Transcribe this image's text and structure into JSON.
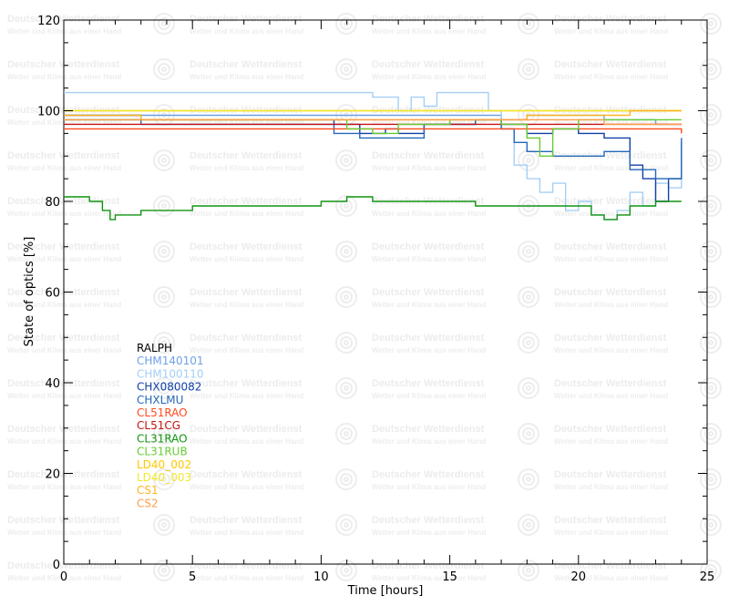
{
  "watermark": {
    "title": "Deutscher Wetterdienst",
    "subtitle": "Wetter und Klima aus einer Hand",
    "logo": "DWD"
  },
  "chart_data": {
    "type": "line",
    "title": "",
    "xlabel": "Time [hours]",
    "ylabel": "State of optics [%]",
    "xlim": [
      0,
      25
    ],
    "ylim": [
      0,
      120
    ],
    "xticks": [
      0,
      5,
      10,
      15,
      20,
      25
    ],
    "yticks": [
      0,
      20,
      40,
      60,
      80,
      100,
      120
    ],
    "grid": false,
    "legend_position": "left-middle",
    "series": [
      {
        "name": "RALPH",
        "color": "#000000",
        "x": [],
        "y": []
      },
      {
        "name": "CHM140101",
        "color": "#6fa0e6",
        "x": [
          0,
          3,
          6,
          9,
          12,
          15,
          17,
          18,
          19,
          20,
          21,
          22,
          23,
          24
        ],
        "y": [
          99,
          99,
          99,
          99,
          99,
          99,
          98,
          99,
          99,
          99,
          98,
          98,
          97,
          97
        ]
      },
      {
        "name": "CHM100110",
        "color": "#a5cff5",
        "x": [
          0,
          2,
          4,
          6,
          8,
          10,
          12,
          13,
          13.5,
          14,
          14.5,
          15,
          16,
          16.5,
          17,
          17.5,
          18,
          18.5,
          19,
          19.5,
          20,
          20.5,
          21,
          21.5,
          22,
          22.5,
          23,
          23.5,
          24
        ],
        "y": [
          104,
          104,
          104,
          104,
          104,
          104,
          103,
          100,
          103,
          101,
          104,
          104,
          104,
          100,
          96,
          88,
          85,
          82,
          84,
          78,
          80,
          77,
          76,
          78,
          82,
          79,
          84,
          83,
          88
        ]
      },
      {
        "name": "CHX080082",
        "color": "#1040a8",
        "x": [
          0,
          3,
          6,
          9,
          10.5,
          11.5,
          12.5,
          13,
          14,
          15,
          16,
          17,
          18,
          19,
          20,
          21,
          22,
          22.5,
          23,
          23.5,
          24
        ],
        "y": [
          99,
          98,
          98,
          98,
          97,
          95,
          96,
          95,
          97,
          97,
          98,
          97,
          95,
          96,
          95,
          94,
          88,
          85,
          80,
          85,
          93
        ]
      },
      {
        "name": "CHXLMU",
        "color": "#2468b8",
        "x": [
          0,
          3,
          6,
          9,
          10.5,
          11.5,
          12.5,
          14,
          15,
          16,
          17,
          17.5,
          18,
          19,
          20,
          21,
          22,
          23,
          24
        ],
        "y": [
          98,
          97,
          97,
          97,
          95,
          94,
          94,
          97,
          97,
          98,
          96,
          93,
          91,
          90,
          90,
          91,
          87,
          85,
          94
        ]
      },
      {
        "name": "CL51RAO",
        "color": "#ff4a1c",
        "x": [
          0,
          3,
          6,
          9,
          12,
          15,
          18,
          21,
          24
        ],
        "y": [
          96,
          96,
          96,
          96,
          96,
          96,
          96,
          96,
          95
        ]
      },
      {
        "name": "CL51CG",
        "color": "#c41414",
        "x": [
          0,
          3,
          6,
          9,
          12,
          15,
          18,
          21,
          24
        ],
        "y": [
          97,
          97,
          97,
          97,
          97,
          97,
          97,
          97,
          97
        ]
      },
      {
        "name": "CL31RAO",
        "color": "#119411",
        "x": [
          0,
          1,
          1.5,
          1.8,
          2,
          3,
          5,
          8,
          10,
          11,
          12,
          14,
          16,
          17,
          18,
          19,
          20,
          20.5,
          21,
          21.5,
          22,
          23,
          24
        ],
        "y": [
          81,
          80,
          78,
          76,
          77,
          78,
          79,
          79,
          80,
          81,
          80,
          80,
          79,
          79,
          79,
          79,
          79,
          77,
          76,
          77,
          79,
          80,
          80
        ]
      },
      {
        "name": "CL31RUB",
        "color": "#66cc33",
        "x": [
          0,
          4,
          8,
          10,
          11,
          12,
          13,
          15,
          17,
          18,
          18.5,
          19,
          20,
          24
        ],
        "y": [
          98,
          98,
          98,
          98,
          96,
          95,
          97,
          98,
          97,
          94,
          90,
          96,
          98,
          98
        ]
      },
      {
        "name": "LD40_002",
        "color": "#ffc800",
        "x": [
          0,
          6,
          12,
          18,
          24
        ],
        "y": [
          100,
          100,
          100,
          100,
          100
        ]
      },
      {
        "name": "LD40_003",
        "color": "#f2e82e",
        "x": [
          0,
          6,
          12,
          18,
          24
        ],
        "y": [
          100,
          100,
          100,
          100,
          100
        ]
      },
      {
        "name": "CS1",
        "color": "#ffb41e",
        "x": [
          0,
          3,
          6,
          9,
          12,
          15,
          18,
          20,
          22,
          24
        ],
        "y": [
          99,
          98,
          98,
          98,
          98,
          98,
          99,
          99,
          100,
          100
        ]
      },
      {
        "name": "CS2",
        "color": "#ff9e4a",
        "x": [
          0,
          3,
          6,
          9,
          12,
          15,
          18,
          21,
          24
        ],
        "y": [
          98,
          98,
          98,
          98,
          98,
          98,
          98,
          97,
          97
        ]
      }
    ]
  }
}
